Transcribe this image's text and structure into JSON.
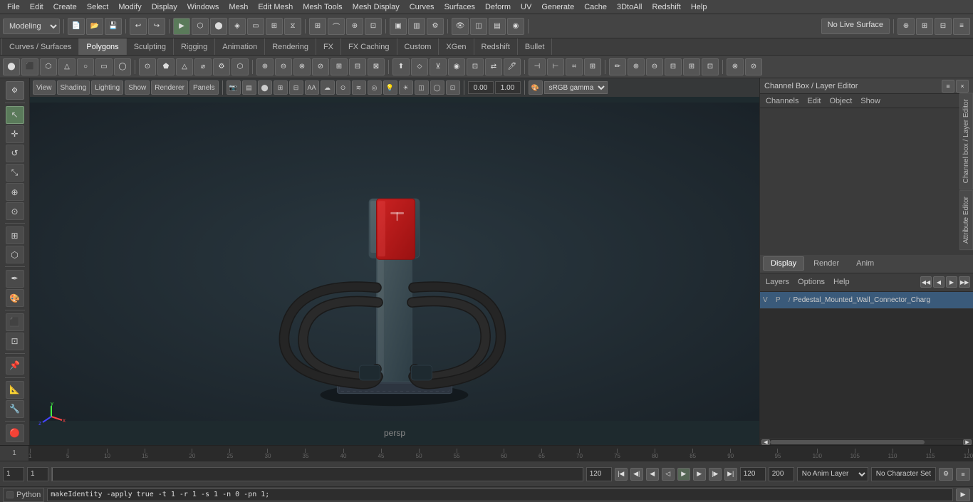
{
  "app": {
    "title": "Maya"
  },
  "menubar": {
    "items": [
      "File",
      "Edit",
      "Create",
      "Select",
      "Modify",
      "Display",
      "Windows",
      "Mesh",
      "Edit Mesh",
      "Mesh Tools",
      "Mesh Display",
      "Curves",
      "Surfaces",
      "Deform",
      "UV",
      "Generate",
      "Cache",
      "3DtoAll",
      "Redshift",
      "Help"
    ]
  },
  "toolbar1": {
    "workspace_label": "Modeling",
    "live_surface": "No Live Surface"
  },
  "tabs": {
    "items": [
      "Curves / Surfaces",
      "Polygons",
      "Sculpting",
      "Rigging",
      "Animation",
      "Rendering",
      "FX",
      "FX Caching",
      "Custom",
      "XGen",
      "Redshift",
      "Bullet"
    ],
    "active": "Polygons"
  },
  "viewport": {
    "label": "persp",
    "camera_angle": "0.00",
    "camera_scale": "1.00",
    "color_space": "sRGB gamma",
    "view_menu": "View",
    "shading_menu": "Shading",
    "lighting_menu": "Lighting",
    "show_menu": "Show",
    "renderer_menu": "Renderer",
    "panels_menu": "Panels"
  },
  "right_panel": {
    "title": "Channel Box / Layer Editor",
    "tabs": {
      "channels": "Channels",
      "edit": "Edit",
      "object": "Object",
      "show": "Show"
    },
    "display_tabs": [
      "Display",
      "Render",
      "Anim"
    ],
    "active_display_tab": "Display",
    "layers_tabs": [
      "Layers",
      "Options",
      "Help"
    ],
    "layer_item": {
      "vp": "V",
      "p": "P",
      "name": "Pedestal_Mounted_Wall_Connector_Charg"
    }
  },
  "timeline": {
    "start": "1",
    "end": "120",
    "current": "1",
    "playback_start": "1",
    "playback_end": "120",
    "range_end": "200",
    "ticks": [
      "1",
      "5",
      "10",
      "15",
      "20",
      "25",
      "30",
      "35",
      "40",
      "45",
      "50",
      "55",
      "60",
      "65",
      "70",
      "75",
      "80",
      "85",
      "90",
      "95",
      "100",
      "105",
      "110",
      "115",
      "120"
    ]
  },
  "status_bar": {
    "frame_start": "1",
    "frame_current": "1",
    "frame_end_playback": "120",
    "frame_end_range": "200",
    "anim_layer": "No Anim Layer",
    "char_set": "No Character Set"
  },
  "bottom_bar": {
    "python_label": "Python",
    "script_content": "makeIdentity -apply true -t 1 -r 1 -s 1 -n 0 -pn 1;"
  },
  "model": {
    "description": "Tesla EV Charging Station Pedestal"
  }
}
